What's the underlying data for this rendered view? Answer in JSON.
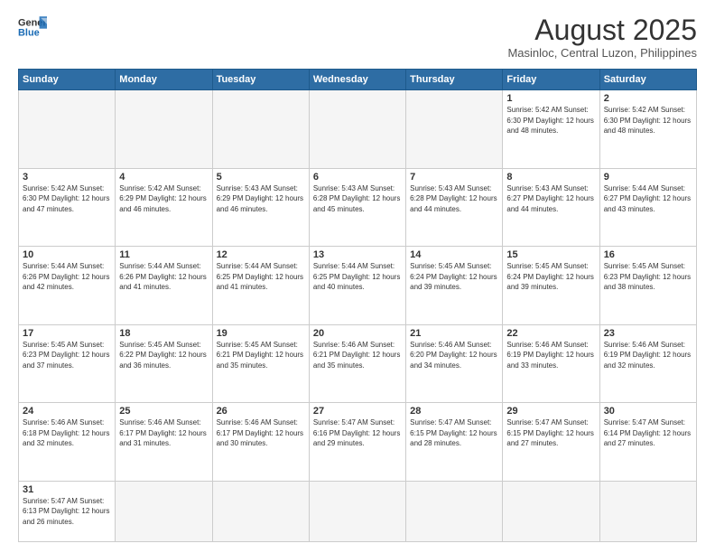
{
  "header": {
    "logo_general": "General",
    "logo_blue": "Blue",
    "month_year": "August 2025",
    "location": "Masinloc, Central Luzon, Philippines"
  },
  "days_of_week": [
    "Sunday",
    "Monday",
    "Tuesday",
    "Wednesday",
    "Thursday",
    "Friday",
    "Saturday"
  ],
  "weeks": [
    {
      "days": [
        {
          "num": "",
          "info": ""
        },
        {
          "num": "",
          "info": ""
        },
        {
          "num": "",
          "info": ""
        },
        {
          "num": "",
          "info": ""
        },
        {
          "num": "",
          "info": ""
        },
        {
          "num": "1",
          "info": "Sunrise: 5:42 AM\nSunset: 6:30 PM\nDaylight: 12 hours and 48 minutes."
        },
        {
          "num": "2",
          "info": "Sunrise: 5:42 AM\nSunset: 6:30 PM\nDaylight: 12 hours and 48 minutes."
        }
      ]
    },
    {
      "days": [
        {
          "num": "3",
          "info": "Sunrise: 5:42 AM\nSunset: 6:30 PM\nDaylight: 12 hours and 47 minutes."
        },
        {
          "num": "4",
          "info": "Sunrise: 5:42 AM\nSunset: 6:29 PM\nDaylight: 12 hours and 46 minutes."
        },
        {
          "num": "5",
          "info": "Sunrise: 5:43 AM\nSunset: 6:29 PM\nDaylight: 12 hours and 46 minutes."
        },
        {
          "num": "6",
          "info": "Sunrise: 5:43 AM\nSunset: 6:28 PM\nDaylight: 12 hours and 45 minutes."
        },
        {
          "num": "7",
          "info": "Sunrise: 5:43 AM\nSunset: 6:28 PM\nDaylight: 12 hours and 44 minutes."
        },
        {
          "num": "8",
          "info": "Sunrise: 5:43 AM\nSunset: 6:27 PM\nDaylight: 12 hours and 44 minutes."
        },
        {
          "num": "9",
          "info": "Sunrise: 5:44 AM\nSunset: 6:27 PM\nDaylight: 12 hours and 43 minutes."
        }
      ]
    },
    {
      "days": [
        {
          "num": "10",
          "info": "Sunrise: 5:44 AM\nSunset: 6:26 PM\nDaylight: 12 hours and 42 minutes."
        },
        {
          "num": "11",
          "info": "Sunrise: 5:44 AM\nSunset: 6:26 PM\nDaylight: 12 hours and 41 minutes."
        },
        {
          "num": "12",
          "info": "Sunrise: 5:44 AM\nSunset: 6:25 PM\nDaylight: 12 hours and 41 minutes."
        },
        {
          "num": "13",
          "info": "Sunrise: 5:44 AM\nSunset: 6:25 PM\nDaylight: 12 hours and 40 minutes."
        },
        {
          "num": "14",
          "info": "Sunrise: 5:45 AM\nSunset: 6:24 PM\nDaylight: 12 hours and 39 minutes."
        },
        {
          "num": "15",
          "info": "Sunrise: 5:45 AM\nSunset: 6:24 PM\nDaylight: 12 hours and 39 minutes."
        },
        {
          "num": "16",
          "info": "Sunrise: 5:45 AM\nSunset: 6:23 PM\nDaylight: 12 hours and 38 minutes."
        }
      ]
    },
    {
      "days": [
        {
          "num": "17",
          "info": "Sunrise: 5:45 AM\nSunset: 6:23 PM\nDaylight: 12 hours and 37 minutes."
        },
        {
          "num": "18",
          "info": "Sunrise: 5:45 AM\nSunset: 6:22 PM\nDaylight: 12 hours and 36 minutes."
        },
        {
          "num": "19",
          "info": "Sunrise: 5:45 AM\nSunset: 6:21 PM\nDaylight: 12 hours and 35 minutes."
        },
        {
          "num": "20",
          "info": "Sunrise: 5:46 AM\nSunset: 6:21 PM\nDaylight: 12 hours and 35 minutes."
        },
        {
          "num": "21",
          "info": "Sunrise: 5:46 AM\nSunset: 6:20 PM\nDaylight: 12 hours and 34 minutes."
        },
        {
          "num": "22",
          "info": "Sunrise: 5:46 AM\nSunset: 6:19 PM\nDaylight: 12 hours and 33 minutes."
        },
        {
          "num": "23",
          "info": "Sunrise: 5:46 AM\nSunset: 6:19 PM\nDaylight: 12 hours and 32 minutes."
        }
      ]
    },
    {
      "days": [
        {
          "num": "24",
          "info": "Sunrise: 5:46 AM\nSunset: 6:18 PM\nDaylight: 12 hours and 32 minutes."
        },
        {
          "num": "25",
          "info": "Sunrise: 5:46 AM\nSunset: 6:17 PM\nDaylight: 12 hours and 31 minutes."
        },
        {
          "num": "26",
          "info": "Sunrise: 5:46 AM\nSunset: 6:17 PM\nDaylight: 12 hours and 30 minutes."
        },
        {
          "num": "27",
          "info": "Sunrise: 5:47 AM\nSunset: 6:16 PM\nDaylight: 12 hours and 29 minutes."
        },
        {
          "num": "28",
          "info": "Sunrise: 5:47 AM\nSunset: 6:15 PM\nDaylight: 12 hours and 28 minutes."
        },
        {
          "num": "29",
          "info": "Sunrise: 5:47 AM\nSunset: 6:15 PM\nDaylight: 12 hours and 27 minutes."
        },
        {
          "num": "30",
          "info": "Sunrise: 5:47 AM\nSunset: 6:14 PM\nDaylight: 12 hours and 27 minutes."
        }
      ]
    },
    {
      "days": [
        {
          "num": "31",
          "info": "Sunrise: 5:47 AM\nSunset: 6:13 PM\nDaylight: 12 hours and 26 minutes."
        },
        {
          "num": "",
          "info": ""
        },
        {
          "num": "",
          "info": ""
        },
        {
          "num": "",
          "info": ""
        },
        {
          "num": "",
          "info": ""
        },
        {
          "num": "",
          "info": ""
        },
        {
          "num": "",
          "info": ""
        }
      ]
    }
  ]
}
